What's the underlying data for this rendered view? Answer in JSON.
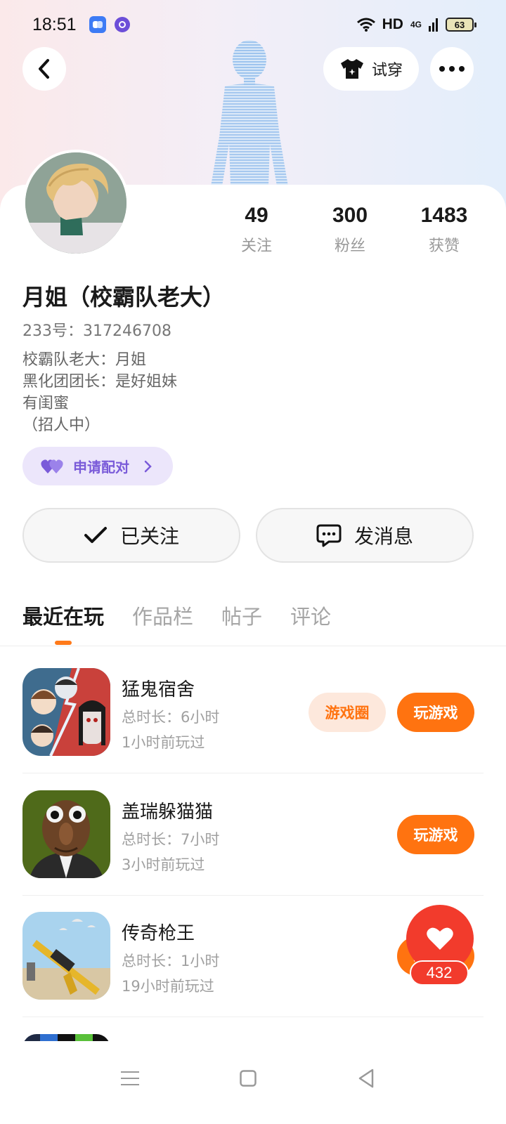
{
  "status_bar": {
    "time": "18:51",
    "network": "HD",
    "signal": "4G",
    "battery": "63"
  },
  "header": {
    "tryon_label": "试穿"
  },
  "profile": {
    "name": "月姐（校霸队老大）",
    "uid": "233号：317246708",
    "bio": [
      "校霸队老大：月姐",
      "黑化团团长：是好姐妹",
      "有闺蜜",
      "（招人中）"
    ],
    "stats": [
      {
        "value": "49",
        "label": "关注"
      },
      {
        "value": "300",
        "label": "粉丝"
      },
      {
        "value": "1483",
        "label": "获赞"
      }
    ],
    "match_label": "申请配对",
    "follow_label": "已关注",
    "message_label": "发消息"
  },
  "tabs": [
    "最近在玩",
    "作品栏",
    "帖子",
    "评论"
  ],
  "games": [
    {
      "title": "猛鬼宿舍",
      "duration": "总时长：6小时",
      "last_played": "1小时前玩过",
      "circle_label": "游戏圈",
      "play_label": "玩游戏"
    },
    {
      "title": "盖瑞躲猫猫",
      "duration": "总时长：7小时",
      "last_played": "3小时前玩过",
      "play_label": "玩游戏"
    },
    {
      "title": "传奇枪王",
      "duration": "总时长：1小时",
      "last_played": "19小时前玩过",
      "play_label": "玩游戏"
    }
  ],
  "like": {
    "count": "432"
  },
  "colors": {
    "accent": "#ff7310",
    "like": "#f23b2c",
    "match": "#7a5bd9"
  }
}
